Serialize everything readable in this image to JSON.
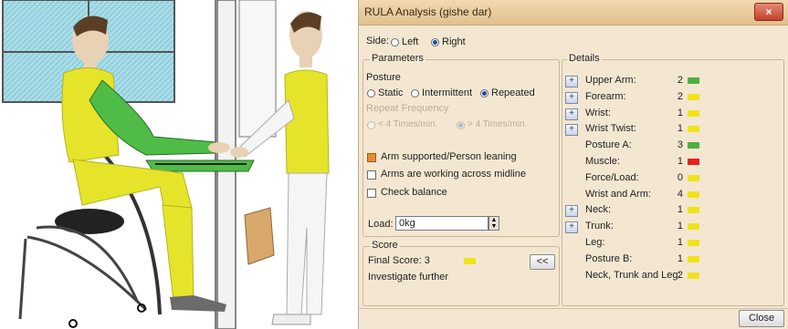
{
  "window": {
    "title": "RULA Analysis (gishe dar)",
    "close_glyph": "×"
  },
  "side": {
    "label": "Side:",
    "options": [
      "Left",
      "Right"
    ],
    "selected": "Right"
  },
  "parameters": {
    "group_title": "Parameters",
    "posture_label": "Posture",
    "posture_options": [
      "Static",
      "Intermittent",
      "Repeated"
    ],
    "posture_selected": "Repeated",
    "repeat_label": "Repeat Frequency",
    "repeat_options": [
      "< 4 Times/min.",
      "> 4 Times/min."
    ],
    "repeat_selected": "> 4 Times/min.",
    "checks": [
      {
        "label": "Arm supported/Person leaning",
        "checked": true
      },
      {
        "label": "Arms are working across midline",
        "checked": false
      },
      {
        "label": "Check balance",
        "checked": false
      }
    ],
    "load_label": "Load:",
    "load_value": "0kg"
  },
  "score": {
    "group_title": "Score",
    "final_label": "Final Score: 3",
    "final_color": "#f1e21a",
    "message": "Investigate further",
    "collapse_label": "<<"
  },
  "details": {
    "group_title": "Details",
    "rows": [
      {
        "label": "Upper Arm:",
        "value": "2",
        "color": "#4caf3f",
        "expand": true
      },
      {
        "label": "Forearm:",
        "value": "2",
        "color": "#f1e21a",
        "expand": true
      },
      {
        "label": "Wrist:",
        "value": "1",
        "color": "#f1e21a",
        "expand": true
      },
      {
        "label": "Wrist Twist:",
        "value": "1",
        "color": "#f1e21a",
        "expand": true
      },
      {
        "label": "Posture A:",
        "value": "3",
        "color": "#4caf3f",
        "expand": false
      },
      {
        "label": "Muscle:",
        "value": "1",
        "color": "#e5241b",
        "expand": false
      },
      {
        "label": "Force/Load:",
        "value": "0",
        "color": "#f1e21a",
        "expand": false
      },
      {
        "label": "Wrist and Arm:",
        "value": "4",
        "color": "#f1e21a",
        "expand": false
      },
      {
        "label": "Neck:",
        "value": "1",
        "color": "#f1e21a",
        "expand": true
      },
      {
        "label": "Trunk:",
        "value": "1",
        "color": "#f1e21a",
        "expand": true
      },
      {
        "label": "Leg:",
        "value": "1",
        "color": "#f1e21a",
        "expand": false
      },
      {
        "label": "Posture B:",
        "value": "1",
        "color": "#f1e21a",
        "expand": false
      },
      {
        "label": "Neck, Trunk and Leg:",
        "value": "2",
        "color": "#f1e21a",
        "expand": false
      }
    ],
    "expand_glyph": "+"
  },
  "footer": {
    "close_label": "Close"
  },
  "colors": {
    "mannequin_suit": "#e6e42a",
    "mannequin_arm": "#4fbc47",
    "window_glass": "#a9dde8"
  }
}
